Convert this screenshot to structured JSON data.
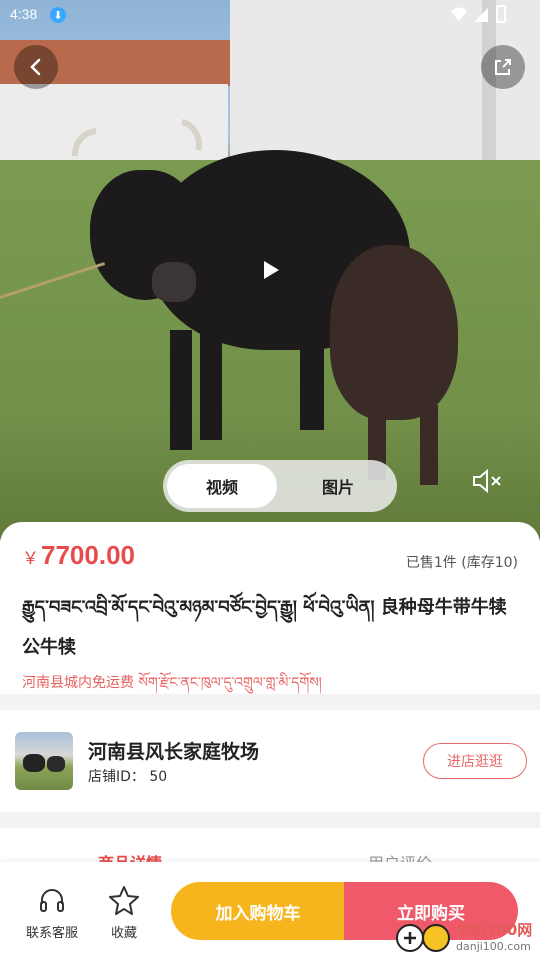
{
  "status_bar": {
    "time": "4:38"
  },
  "media": {
    "toggle": {
      "video_label": "视频",
      "image_label": "图片",
      "active": "video"
    }
  },
  "product": {
    "currency_symbol": "￥",
    "price": "7700.00",
    "sold_text": "已售1件 (库存10)",
    "title": "རྒྱུད་བཟང་འབྲི་མོ་དང་བེའུ་མཉམ་བཙོང་བྱེད་རྒྱུ། ཕོ་བེའུ་ཡིན།   良种母牛带牛犊   公牛犊",
    "shipping_note": "河南县城内免运费   སོག་རྫོང་ནང་ཁུལ་དུ་འགྲུལ་གླ་མི་དགོས།"
  },
  "shop": {
    "name": "河南县风长家庭牧场",
    "id_text": "店铺ID： 50",
    "enter_button": "进店逛逛"
  },
  "tabs": {
    "detail": "商品详情",
    "reviews": "用户评价"
  },
  "bottom_bar": {
    "service_label": "联系客服",
    "favorite_label": "收藏",
    "add_to_cart": "加入购物车",
    "buy_now": "立即购买"
  },
  "watermark": {
    "brand": "单机100网",
    "url": "danji100.com"
  },
  "colors": {
    "accent": "#e84b4b",
    "cart": "#f7b51d",
    "buy": "#f0596a"
  }
}
